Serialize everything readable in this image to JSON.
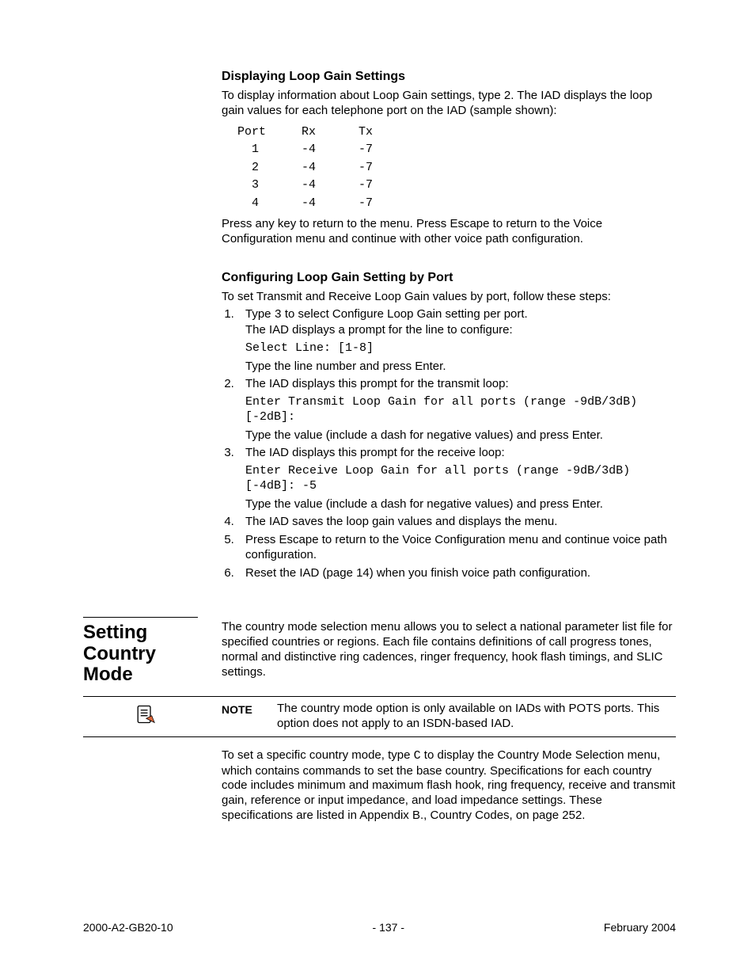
{
  "sec1": {
    "heading": "Displaying Loop Gain Settings",
    "intro": "To display information about Loop Gain settings, type 2. The IAD displays the loop gain values for each telephone port on the IAD (sample shown):",
    "table": "Port     Rx      Tx\n  1      -4      -7\n  2      -4      -7\n  3      -4      -7\n  4      -4      -7",
    "after": "Press any key to return to the menu. Press Escape to return to the Voice Configuration menu and continue with other voice path configuration."
  },
  "sec2": {
    "heading": "Configuring Loop Gain Setting by Port",
    "intro": "To set Transmit and Receive Loop Gain values by port, follow these steps:",
    "s1a": "Type ",
    "s1a_mono": "3",
    "s1b": " to select Configure Loop Gain setting per port.",
    "s1c": "The IAD displays a prompt for the line to configure:",
    "s1d": "Select Line: [1-8]",
    "s1e": "Type the line number and press Enter.",
    "s2a": "The IAD displays this prompt for the transmit loop:",
    "s2b": "Enter Transmit Loop Gain for all ports (range -9dB/3dB) [-2dB]:",
    "s2c": "Type the value (include a dash for negative values) and press Enter.",
    "s3a": "The IAD displays this prompt for the receive loop:",
    "s3b": "Enter Receive Loop Gain for all ports (range -9dB/3dB) [-4dB]: -5",
    "s3c": "Type the value (include a dash for negative values) and press Enter.",
    "s4": "The IAD saves the loop gain values and displays the menu.",
    "s5": "Press Escape to return to the Voice Configuration menu and continue voice path configuration.",
    "s6": "Reset the IAD (page 14) when you finish voice path configuration."
  },
  "sec3": {
    "side_heading": "Setting Country Mode",
    "body1": "The country mode selection menu allows you to select a national parameter list file for specified countries or regions. Each file contains definitions of call progress tones, normal and distinctive ring cadences, ringer frequency, hook flash timings, and SLIC settings.",
    "note_label": "NOTE",
    "note_text": "The country mode option is only available on IADs with POTS ports. This option does not apply to an ISDN-based IAD.",
    "body2a": "To set a specific country mode, type ",
    "body2mono": "C",
    "body2b": " to display the Country Mode Selection menu, which contains commands to set the base country. Specifications for each country code includes minimum and maximum flash hook, ring frequency, receive and transmit gain, reference or input impedance, and load impedance settings. These specifications are listed in Appendix B., Country Codes, on page 252."
  },
  "footer": {
    "left": "2000-A2-GB20-10",
    "center": "- 137 -",
    "right": "February 2004"
  }
}
